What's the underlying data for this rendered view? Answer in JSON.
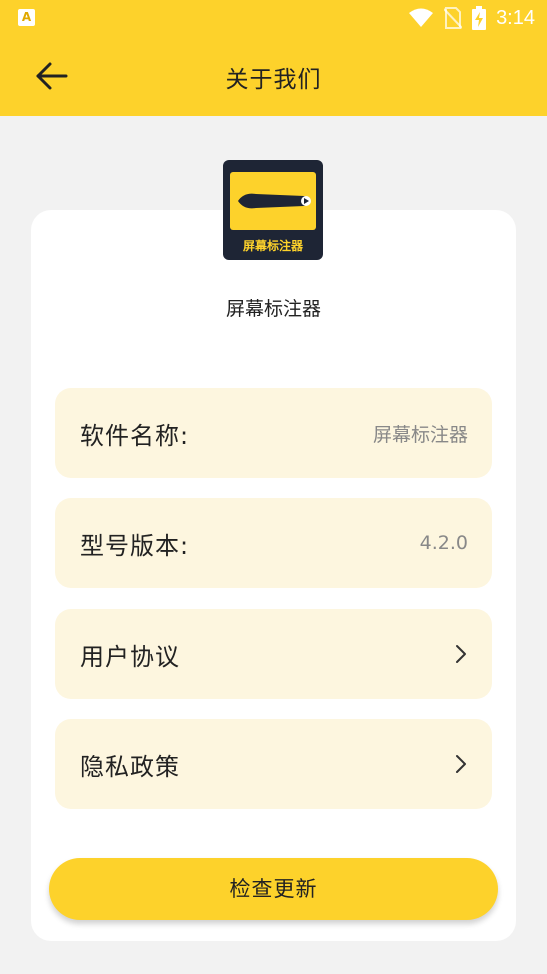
{
  "status_bar": {
    "app_icon_letter": "A",
    "time": "3:14",
    "icons": [
      "wifi-icon",
      "no-sim-icon",
      "battery-charging-icon"
    ]
  },
  "header": {
    "title": "关于我们",
    "back_icon": "arrow-left-icon"
  },
  "app": {
    "logo_caption": "屏幕标注器",
    "name": "屏幕标注器"
  },
  "rows": [
    {
      "label": "软件名称:",
      "value": "屏幕标注器"
    },
    {
      "label": "型号版本:",
      "value": "4.2.0"
    },
    {
      "label": "用户协议",
      "icon": "chevron-right-icon"
    },
    {
      "label": "隐私政策",
      "icon": "chevron-right-icon"
    }
  ],
  "actions": {
    "check_update_label": "检查更新"
  },
  "colors": {
    "accent": "#fdd22b",
    "row_background": "#fdf6df",
    "page_background": "#f2f2f2",
    "logo_background": "#1e2535"
  }
}
